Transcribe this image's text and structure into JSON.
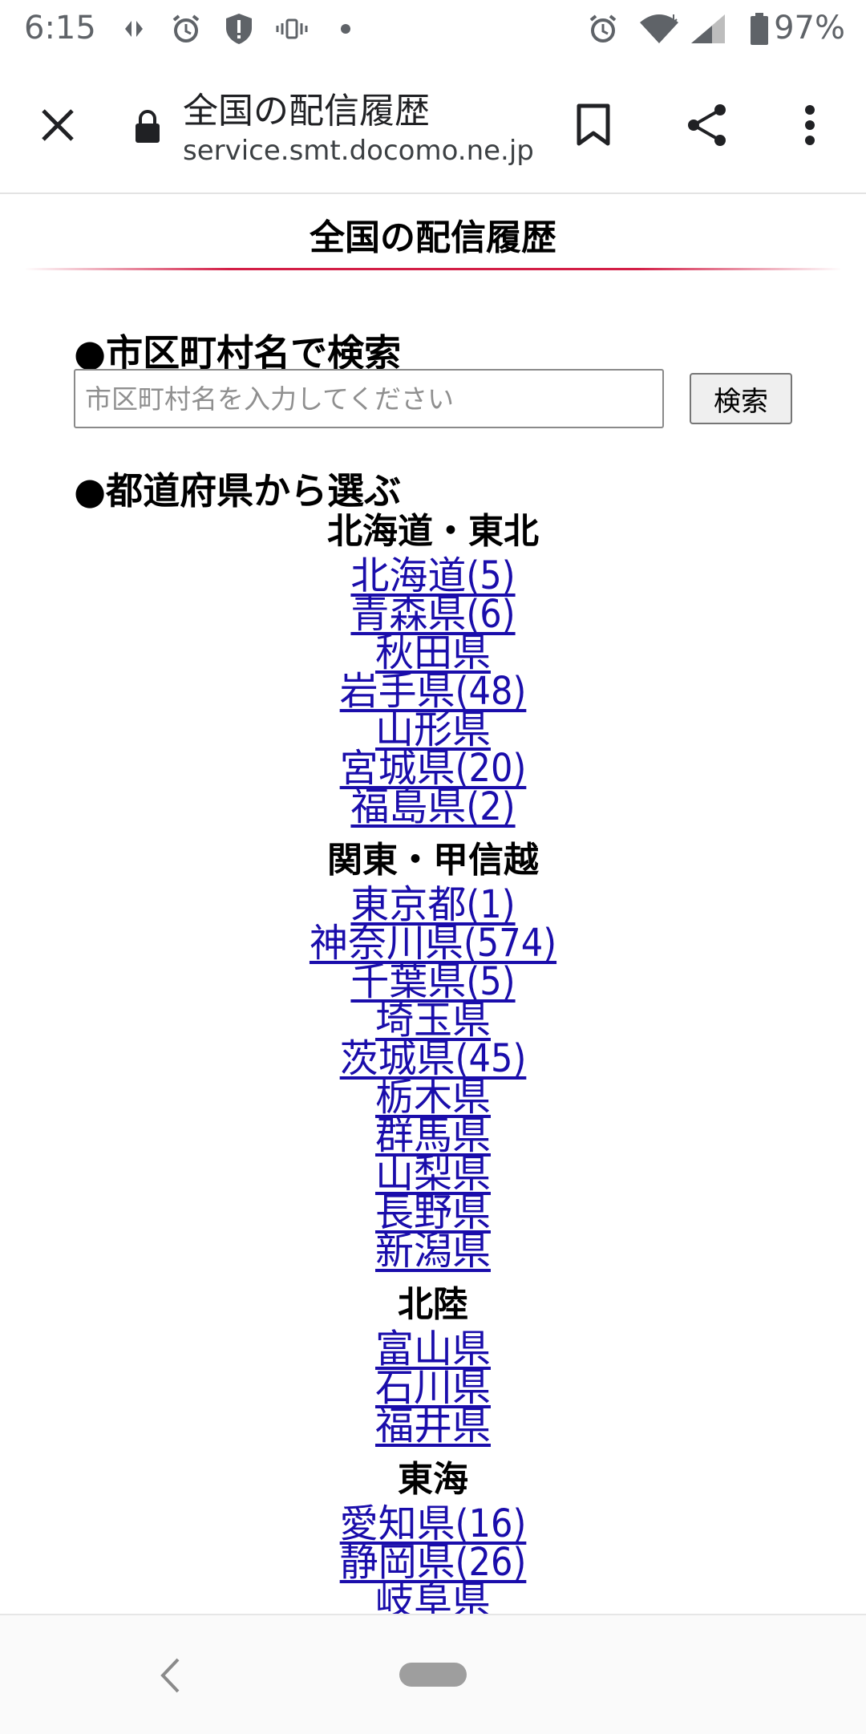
{
  "status_bar": {
    "time": "6:15",
    "battery_percent": "97%",
    "icons_left": [
      "nfc-icon",
      "alarm-icon",
      "shield-icon",
      "vibrate-icon",
      "dot-icon"
    ],
    "icons_right": [
      "alarm-icon",
      "wifi-icon",
      "signal-icon",
      "battery-icon"
    ]
  },
  "toolbar": {
    "page_title": "全国の配信履歴",
    "url": "service.smt.docomo.ne.jp",
    "icons": [
      "close-icon",
      "lock-icon",
      "bookmark-icon",
      "share-icon",
      "more-vert-icon"
    ]
  },
  "page": {
    "title": "全国の配信履歴",
    "search_heading": "●市区町村名で検索",
    "search_placeholder": "市区町村名を入力してください",
    "search_button": "検索",
    "prefecture_heading": "●都道府県から選ぶ"
  },
  "regions": [
    {
      "name": "北海道・東北",
      "prefectures": [
        "北海道(5)",
        "青森県(6)",
        "秋田県",
        "岩手県(48)",
        "山形県",
        "宮城県(20)",
        "福島県(2)"
      ]
    },
    {
      "name": "関東・甲信越",
      "prefectures": [
        "東京都(1)",
        "神奈川県(574)",
        "千葉県(5)",
        "埼玉県",
        "茨城県(45)",
        "栃木県",
        "群馬県",
        "山梨県",
        "長野県",
        "新潟県"
      ]
    },
    {
      "name": "北陸",
      "prefectures": [
        "富山県",
        "石川県",
        "福井県"
      ]
    },
    {
      "name": "東海",
      "prefectures": [
        "愛知県(16)",
        "静岡県(26)",
        "岐阜県"
      ]
    }
  ],
  "colors": {
    "link": "#1a0dab",
    "header_accent": "#d31e46"
  }
}
